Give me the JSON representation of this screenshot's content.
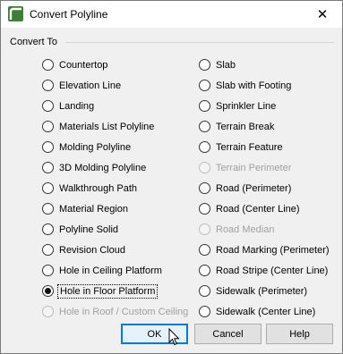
{
  "window": {
    "title": "Convert Polyline",
    "close_glyph": "✕"
  },
  "group": {
    "label": "Convert To"
  },
  "left_options": [
    {
      "label": "Countertop",
      "checked": false,
      "enabled": true
    },
    {
      "label": "Elevation Line",
      "checked": false,
      "enabled": true
    },
    {
      "label": "Landing",
      "checked": false,
      "enabled": true
    },
    {
      "label": "Materials List Polyline",
      "checked": false,
      "enabled": true
    },
    {
      "label": "Molding Polyline",
      "checked": false,
      "enabled": true
    },
    {
      "label": "3D Molding Polyline",
      "checked": false,
      "enabled": true
    },
    {
      "label": "Walkthrough Path",
      "checked": false,
      "enabled": true
    },
    {
      "label": "Material Region",
      "checked": false,
      "enabled": true
    },
    {
      "label": "Polyline Solid",
      "checked": false,
      "enabled": true
    },
    {
      "label": "Revision Cloud",
      "checked": false,
      "enabled": true
    },
    {
      "label": "Hole in Ceiling Platform",
      "checked": false,
      "enabled": true
    },
    {
      "label": "Hole in Floor Platform",
      "checked": true,
      "enabled": true
    },
    {
      "label": "Hole in Roof / Custom Ceiling",
      "checked": false,
      "enabled": false
    }
  ],
  "right_options": [
    {
      "label": "Slab",
      "checked": false,
      "enabled": true
    },
    {
      "label": "Slab with Footing",
      "checked": false,
      "enabled": true
    },
    {
      "label": "Sprinkler Line",
      "checked": false,
      "enabled": true
    },
    {
      "label": "Terrain Break",
      "checked": false,
      "enabled": true
    },
    {
      "label": "Terrain Feature",
      "checked": false,
      "enabled": true
    },
    {
      "label": "Terrain Perimeter",
      "checked": false,
      "enabled": false
    },
    {
      "label": "Road (Perimeter)",
      "checked": false,
      "enabled": true
    },
    {
      "label": "Road (Center Line)",
      "checked": false,
      "enabled": true
    },
    {
      "label": "Road Median",
      "checked": false,
      "enabled": false
    },
    {
      "label": "Road Marking (Perimeter)",
      "checked": false,
      "enabled": true
    },
    {
      "label": "Road Stripe (Center Line)",
      "checked": false,
      "enabled": true
    },
    {
      "label": "Sidewalk (Perimeter)",
      "checked": false,
      "enabled": true
    },
    {
      "label": "Sidewalk (Center Line)",
      "checked": false,
      "enabled": true
    }
  ],
  "buttons": {
    "ok": "OK",
    "cancel": "Cancel",
    "help": "Help"
  },
  "colors": {
    "accent": "#0078d7",
    "app_icon": "#3e7d3a"
  }
}
